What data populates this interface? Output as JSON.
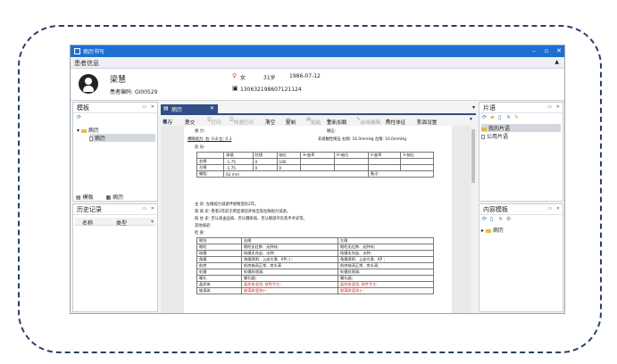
{
  "window": {
    "title": "病历书写",
    "minimize": "–",
    "maximize": "▫",
    "close": "✕"
  },
  "patient_section": {
    "label": "患者信息",
    "collapse_arrow": "▲"
  },
  "patient": {
    "name": "梁慧",
    "code_label": "患者编码:",
    "code": "GI00529",
    "gender": "女",
    "age": "31岁",
    "dob": "1986-07-12",
    "phone": "13063219860712112​4"
  },
  "template_panel": {
    "title": "模板",
    "tree": [
      {
        "label": "病历",
        "type": "folder"
      },
      {
        "label": "病历",
        "type": "doc"
      }
    ],
    "bottom_tabs": [
      "模板",
      "病历"
    ]
  },
  "history_panel": {
    "title": "历史记录",
    "columns": [
      "名称",
      "类型"
    ]
  },
  "doc_tab": {
    "label": "病历",
    "close": "✕"
  },
  "editor_toolbar": [
    {
      "label": "保存",
      "enabled": true
    },
    {
      "label": "提交",
      "enabled": true
    },
    {
      "label": "打印",
      "enabled": false
    },
    {
      "label": "快速打印",
      "enabled": false
    },
    {
      "label": "清空",
      "enabled": true
    },
    {
      "label": "复制",
      "enabled": true
    },
    {
      "label": "粘贴",
      "enabled": false
    },
    {
      "label": "重新加载",
      "enabled": true
    },
    {
      "label": "启用编辑",
      "enabled": false
    },
    {
      "label": "阳性体征",
      "enabled": true
    },
    {
      "label": "页面设置",
      "enabled": true
    }
  ],
  "document": {
    "l1_left": "视  力:",
    "l1_right": "眼压:",
    "l2": "裸眼视力:    右: 0.8  左: 0.3",
    "l2_right": "非接触性眼压    右眼: 16.0mmHg 左眼: 16.0mmHg",
    "l3": "验  光:",
    "refraction_header": [
      "",
      "球镜",
      "柱镜",
      "轴位",
      "H-曲率",
      "H-轴位",
      "V-曲率",
      "V-轴位"
    ],
    "refraction_rows": [
      [
        "右眼",
        "-1.75",
        "0",
        "180",
        "",
        "",
        "",
        ""
      ],
      [
        "左眼",
        "-1.75",
        "0",
        "0",
        "",
        "",
        "",
        ""
      ],
      [
        "瞳距:",
        "62 mm",
        "",
        "",
        "",
        "",
        "备注:",
        ""
      ]
    ],
    "chief_complaint": "主  诉:  左眼视力减退伴视物变形2年。",
    "present_history": "现 病 史:  患者2年前无明显诱因开始出现左眼视力减退。",
    "past_history": "既 往 史:  否认高血压病、否认糖尿病、否认眼部外伤及手术史等。",
    "other_history": "其他病史:",
    "exam": "检  查:",
    "exam_header": [
      "眼别",
      "右眼",
      "左眼"
    ],
    "exam_rows": [
      [
        "眼睑",
        "眼睑无红肿、无肿块;",
        "眼睑无红肿、无肿块;"
      ],
      [
        "结膜",
        "结膜无充血、水肿;",
        "结膜无充血、水肿;"
      ],
      [
        "角膜",
        "角膜透明、上皮光滑、KP(-) ;",
        "角膜透明、上皮光滑、KP ;"
      ],
      [
        "前房",
        "前房轴深正常、房水清",
        "前房轴深正常、房水清;"
      ],
      [
        "虹膜",
        "虹膜纹理清;",
        "虹膜纹理清;"
      ],
      [
        "瞳孔",
        "瞳孔圆;",
        "瞳孔圆;"
      ],
      [
        "晶状体",
        "晶状体混浊, 核性为主;",
        "晶状体混浊, 核性为主;"
      ],
      [
        "玻璃体",
        "玻璃体混浊+;",
        "玻璃体混浊+;"
      ]
    ]
  },
  "phrase_panel": {
    "title": "片语",
    "items": [
      {
        "label": "我的片语",
        "type": "folder"
      },
      {
        "label": "公用片语",
        "type": "doc"
      }
    ]
  },
  "content_template_panel": {
    "title": "内容模板",
    "items": [
      {
        "label": "病历",
        "type": "folder"
      }
    ]
  },
  "colors": {
    "accent": "#1e6fd1",
    "tab": "#2f4e84",
    "warn_text": "#e02020"
  }
}
